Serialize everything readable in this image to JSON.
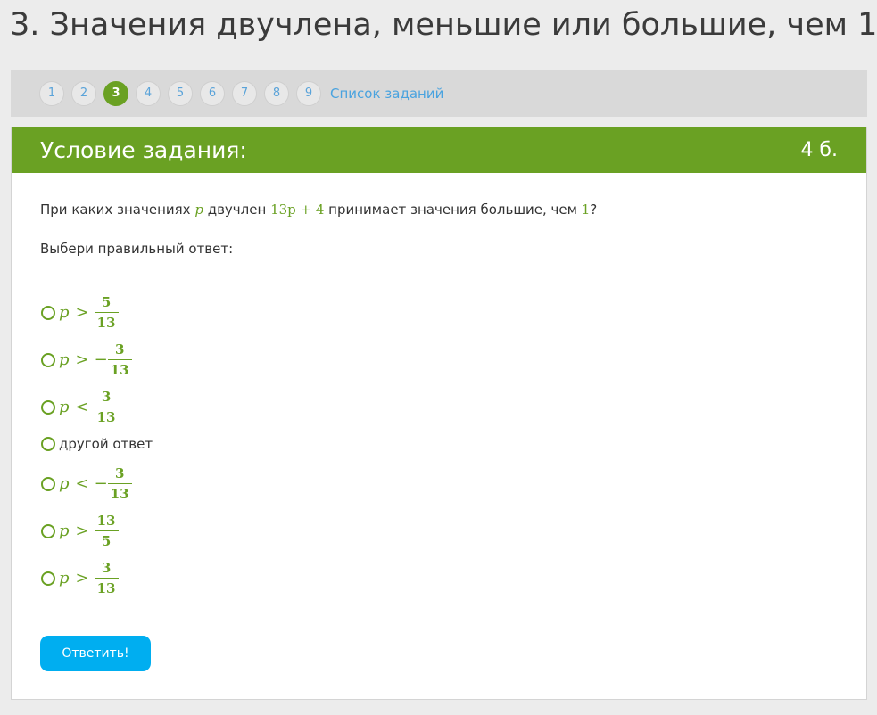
{
  "page": {
    "title": "3. Значения двучлена, меньшие или большие, чем 1"
  },
  "nav": {
    "items": [
      "1",
      "2",
      "3",
      "4",
      "5",
      "6",
      "7",
      "8",
      "9"
    ],
    "active": "3",
    "list_link": "Список заданий"
  },
  "task": {
    "header_title": "Условие задания:",
    "points": "4 б.",
    "question": {
      "part1": "При каких значениях ",
      "var": "p",
      "part2": " двучлен ",
      "expr": "13p + 4",
      "part3": " принимает значения большие, чем ",
      "value": "1",
      "part4": "?"
    },
    "instruction": "Выбери правильный ответ:",
    "options": [
      {
        "var": "p",
        "sign": ">",
        "neg": "",
        "num": "5",
        "den": "13"
      },
      {
        "var": "p",
        "sign": ">",
        "neg": "−",
        "num": "3",
        "den": "13"
      },
      {
        "var": "p",
        "sign": "<",
        "neg": "",
        "num": "3",
        "den": "13"
      },
      {
        "text": "другой ответ"
      },
      {
        "var": "p",
        "sign": "<",
        "neg": "−",
        "num": "3",
        "den": "13"
      },
      {
        "var": "p",
        "sign": ">",
        "neg": "",
        "num": "13",
        "den": "5"
      },
      {
        "var": "p",
        "sign": ">",
        "neg": "",
        "num": "3",
        "den": "13"
      }
    ],
    "submit_label": "Ответить!"
  },
  "colors": {
    "accent_green": "#6aa123",
    "button_blue": "#00aef0",
    "link_blue": "#4aa3df"
  }
}
